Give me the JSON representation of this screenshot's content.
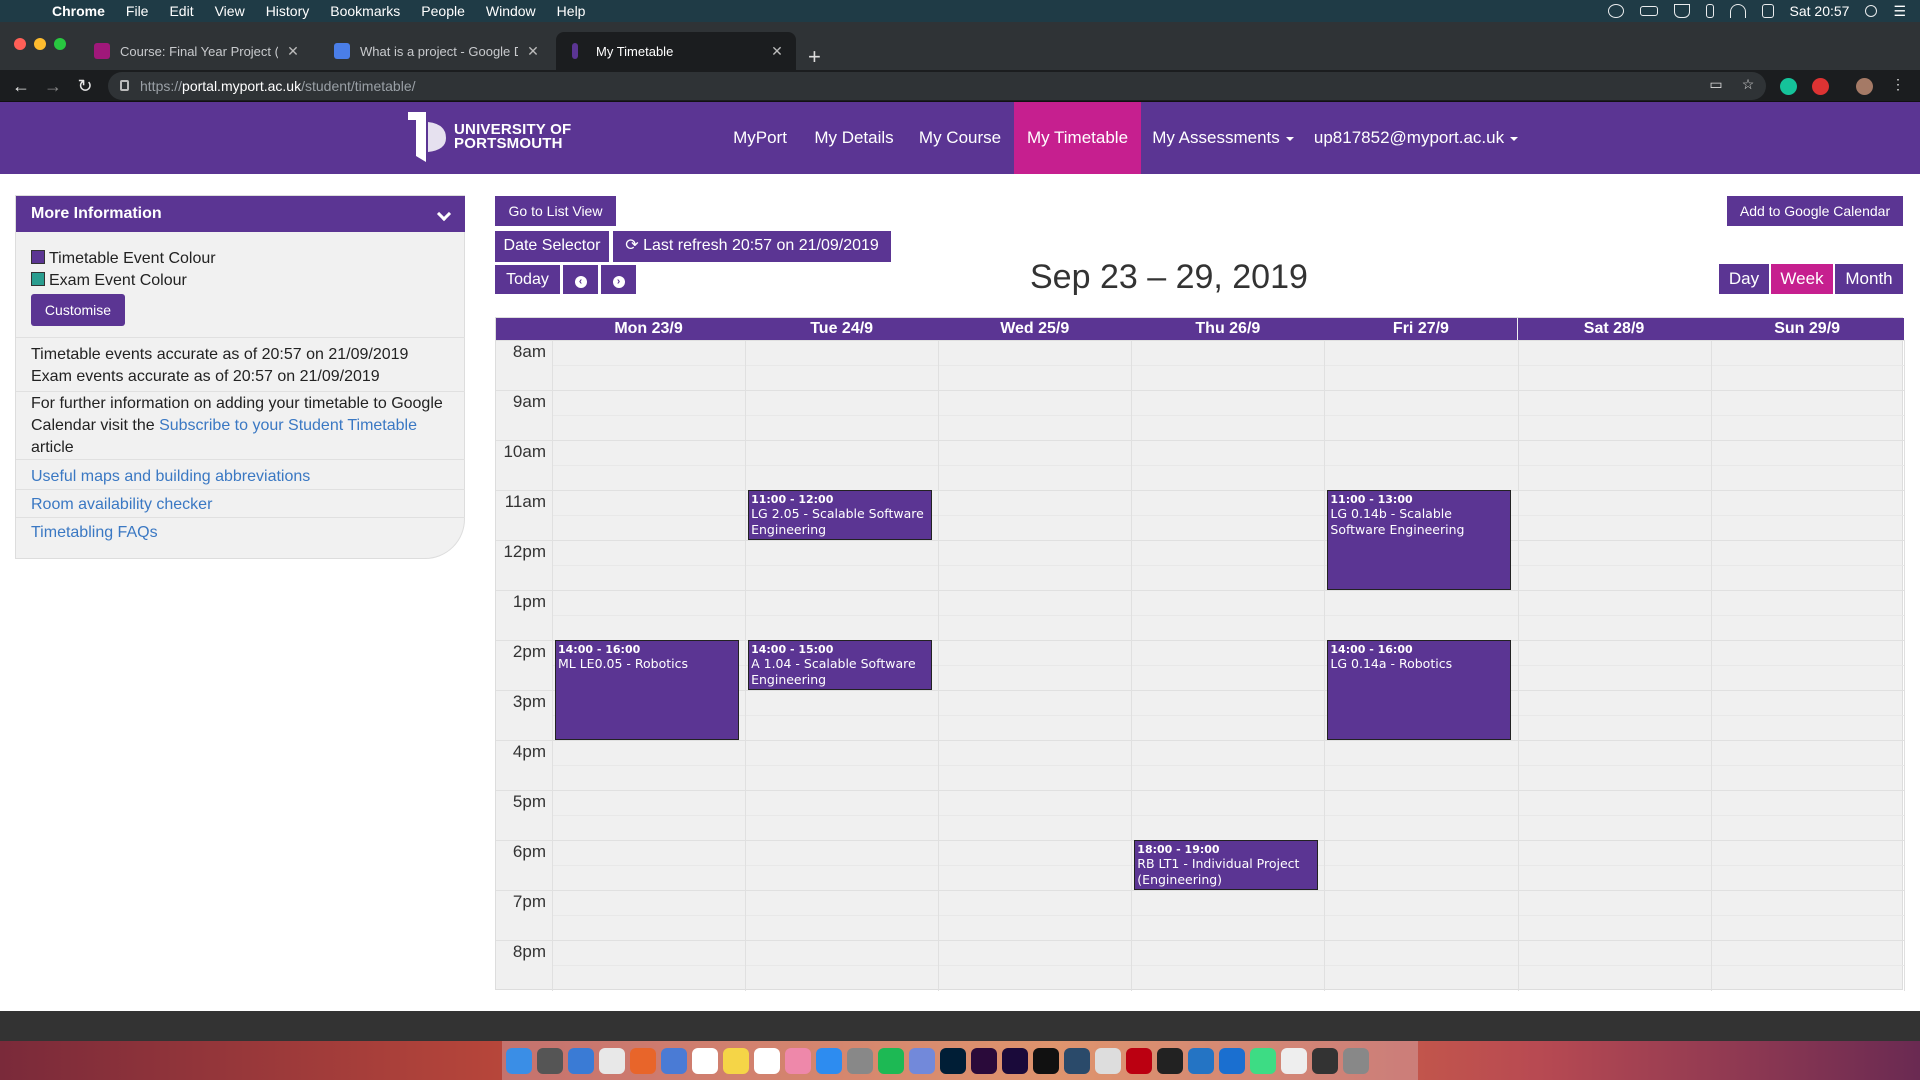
{
  "mac_menu": {
    "app": "Chrome",
    "items": [
      "File",
      "Edit",
      "View",
      "History",
      "Bookmarks",
      "People",
      "Window",
      "Help"
    ],
    "clock": "Sat 20:57"
  },
  "browser": {
    "tabs": [
      {
        "title": "Course: Final Year Project (PJE",
        "favicon_color": "#a0187a"
      },
      {
        "title": "What is a project - Google Doc",
        "favicon_color": "#4a7ee8"
      },
      {
        "title": "My Timetable",
        "favicon_color": "#5b3593"
      }
    ],
    "url": {
      "scheme": "https://",
      "host": "portal.myport.ac.uk",
      "path": "/student/timetable/"
    }
  },
  "site": {
    "logo_line1": "UNIVERSITY OF",
    "logo_line2": "PORTSMOUTH",
    "nav": [
      "MyPort",
      "My Details",
      "My Course",
      "My Timetable",
      "My Assessments",
      "up817852@myport.ac.uk"
    ],
    "active_nav": "My Timetable",
    "colors": {
      "primary": "#5b3593",
      "accent": "#c61f8f",
      "exam": "#2a9d8f"
    }
  },
  "sidebar": {
    "title": "More Information",
    "legend_timetable": "Timetable Event Colour",
    "legend_exam": "Exam Event Colour",
    "customise": "Customise",
    "accuracy_timetable": "Timetable events accurate as of 20:57 on 21/09/2019",
    "accuracy_exam": "Exam events accurate as of 20:57 on 21/09/2019",
    "info_before": "For further information on adding your timetable to Google",
    "info_line2_before": "Calendar visit the ",
    "info_link": "Subscribe to your Student Timetable",
    "info_after": "article",
    "links": [
      "Useful maps and building abbreviations",
      "Room availability checker",
      "Timetabling FAQs"
    ]
  },
  "calendar": {
    "list_view": "Go to List View",
    "google": "Add to Google Calendar",
    "date_selector": "Date Selector",
    "refresh": "Last refresh 20:57 on 21/09/2019",
    "today": "Today",
    "title": "Sep 23 – 29, 2019",
    "views": [
      "Day",
      "Week",
      "Month"
    ],
    "active_view": "Week",
    "days": [
      "Mon 23/9",
      "Tue 24/9",
      "Wed 25/9",
      "Thu 26/9",
      "Fri 27/9",
      "Sat 28/9",
      "Sun 29/9"
    ],
    "hours": [
      "8am",
      "9am",
      "10am",
      "11am",
      "12pm",
      "1pm",
      "2pm",
      "3pm",
      "4pm",
      "5pm",
      "6pm",
      "7pm",
      "8pm"
    ],
    "events": [
      {
        "day": 1,
        "start": 11,
        "end": 12,
        "time": "11:00 - 12:00",
        "desc": "LG 2.05 - Scalable Software Engineering"
      },
      {
        "day": 4,
        "start": 11,
        "end": 13,
        "time": "11:00 - 13:00",
        "desc": "LG 0.14b - Scalable Software Engineering"
      },
      {
        "day": 0,
        "start": 14,
        "end": 16,
        "time": "14:00 - 16:00",
        "desc": "ML LE0.05 - Robotics"
      },
      {
        "day": 1,
        "start": 14,
        "end": 15,
        "time": "14:00 - 15:00",
        "desc": "A 1.04 - Scalable Software Engineering"
      },
      {
        "day": 4,
        "start": 14,
        "end": 16,
        "time": "14:00 - 16:00",
        "desc": "LG 0.14a - Robotics"
      },
      {
        "day": 3,
        "start": 18,
        "end": 19,
        "time": "18:00 - 19:00",
        "desc": "RB LT1 - Individual Project (Engineering)"
      }
    ]
  },
  "dock": {
    "icons": [
      "finder",
      "launchpad",
      "safari",
      "chrome",
      "firefox",
      "mail",
      "calendar",
      "notes",
      "reminders",
      "photos",
      "app-store",
      "settings",
      "spotify",
      "discord",
      "photoshop",
      "premiere",
      "after-effects",
      "terminal",
      "other1",
      "other2",
      "filezilla",
      "github",
      "vscode",
      "xcode",
      "android",
      "file",
      "folder",
      "trash"
    ]
  }
}
